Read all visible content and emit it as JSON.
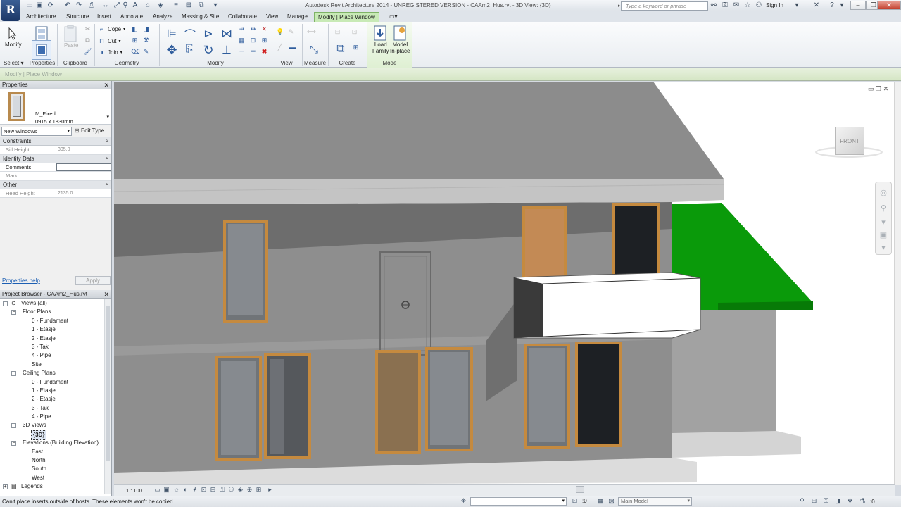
{
  "app": {
    "logo": "R",
    "window_title": "Autodesk Revit Architecture 2014 - UNREGISTERED VERSION -  CAAm2_Hus.rvt - 3D View: {3D}",
    "search_placeholder": "Type a keyword or phrase",
    "sign_in": "Sign In"
  },
  "ribbon": {
    "tabs": [
      "Architecture",
      "Structure",
      "Insert",
      "Annotate",
      "Analyze",
      "Massing & Site",
      "Collaborate",
      "View",
      "Manage"
    ],
    "active_tab": "Modify | Place Window",
    "panels": {
      "select": "Select",
      "properties": "Properties",
      "clipboard": "Clipboard",
      "geometry": "Geometry",
      "modify": "Modify",
      "view": "View",
      "measure": "Measure",
      "create": "Create",
      "mode": "Mode"
    },
    "buttons": {
      "modify": "Modify",
      "paste": "Paste",
      "cope": "Cope",
      "cut": "Cut",
      "join": "Join",
      "load_family_1": "Load",
      "load_family_2": "Family",
      "model_inplace_1": "Model",
      "model_inplace_2": "In-place"
    }
  },
  "options_bar": {
    "context": "Modify | Place Window"
  },
  "properties": {
    "title": "Properties",
    "family": "M_Fixed",
    "type": "0915 x 1830mm",
    "instance_filter": "New Windows",
    "edit_type": "Edit Type",
    "groups": [
      {
        "name": "Constraints",
        "rows": [
          {
            "key": "Sill Height",
            "value": "305.0"
          }
        ]
      },
      {
        "name": "Identity Data",
        "rows": [
          {
            "key": "Comments",
            "value": ""
          },
          {
            "key": "Mark",
            "value": ""
          }
        ]
      },
      {
        "name": "Other",
        "rows": [
          {
            "key": "Head Height",
            "value": "2135.0"
          }
        ]
      }
    ],
    "help": "Properties help",
    "apply": "Apply"
  },
  "browser": {
    "title": "Project Browser - CAAm2_Hus.rvt",
    "items": [
      {
        "label": "Views (all)"
      },
      {
        "label": "Floor Plans"
      },
      {
        "label": "0 - Fundament"
      },
      {
        "label": "1 - Etasje"
      },
      {
        "label": "2 - Etasje"
      },
      {
        "label": "3 - Tak"
      },
      {
        "label": "4 - Pipe"
      },
      {
        "label": "Site"
      },
      {
        "label": "Ceiling Plans"
      },
      {
        "label": "0 - Fundament"
      },
      {
        "label": "1 - Etasje"
      },
      {
        "label": "2 - Etasje"
      },
      {
        "label": "3 - Tak"
      },
      {
        "label": "4 - Pipe"
      },
      {
        "label": "3D Views"
      },
      {
        "label": "{3D}"
      },
      {
        "label": "Elevations (Building Elevation)"
      },
      {
        "label": "East"
      },
      {
        "label": "North"
      },
      {
        "label": "South"
      },
      {
        "label": "West"
      },
      {
        "label": "Legends"
      }
    ]
  },
  "viewport": {
    "scale": "1 : 100",
    "viewcube_face": "FRONT"
  },
  "status": {
    "message": "Can't place inserts outside of hosts. These elements won't be copied.",
    "filter_count": ":0",
    "model": "Main Model"
  },
  "colors": {
    "ribbon_context": "#c8eab6",
    "wall": "#8e8e8e",
    "roof_green": "#0a9a0a",
    "window_frame": "#c58a3f",
    "link": "#1d5fb3"
  }
}
